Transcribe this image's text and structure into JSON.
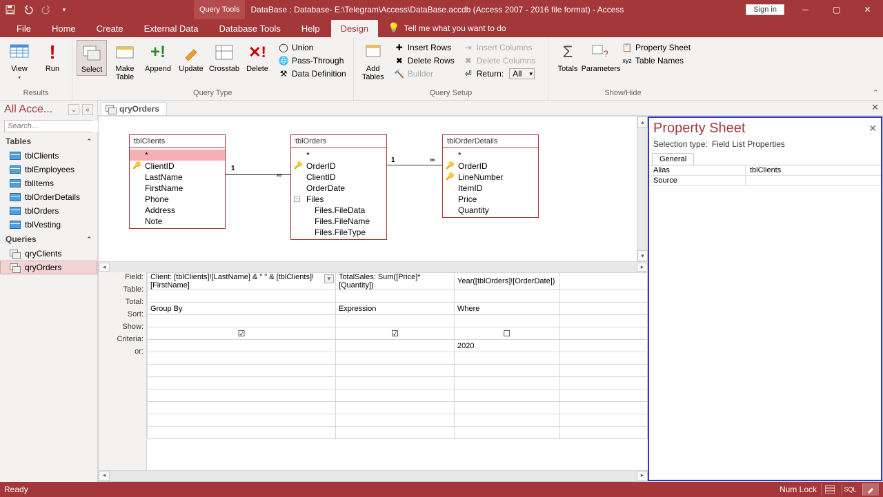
{
  "titlebar": {
    "tool_tab": "Query Tools",
    "title": "DataBase : Database- E:\\Telegram\\Access\\DataBase.accdb (Access 2007 - 2016 file format)  -  Access",
    "signin": "Sign in"
  },
  "tabs": {
    "file": "File",
    "home": "Home",
    "create": "Create",
    "external": "External Data",
    "dbtools": "Database Tools",
    "help": "Help",
    "design": "Design",
    "tellme": "Tell me what you want to do"
  },
  "ribbon": {
    "results": {
      "label": "Results",
      "view": "View",
      "run": "Run"
    },
    "querytype": {
      "label": "Query Type",
      "select": "Select",
      "make_table": "Make\nTable",
      "append": "Append",
      "update": "Update",
      "crosstab": "Crosstab",
      "delete": "Delete",
      "union": "Union",
      "passthrough": "Pass-Through",
      "datadef": "Data Definition"
    },
    "querysetup": {
      "label": "Query Setup",
      "add_tables": "Add\nTables",
      "insert_rows": "Insert Rows",
      "delete_rows": "Delete Rows",
      "builder": "Builder",
      "insert_cols": "Insert Columns",
      "delete_cols": "Delete Columns",
      "return": "Return:",
      "return_val": "All"
    },
    "showhide": {
      "label": "Show/Hide",
      "totals": "Totals",
      "parameters": "Parameters",
      "propsheet": "Property Sheet",
      "tablenames": "Table Names"
    }
  },
  "nav": {
    "title": "All Acce...",
    "search_placeholder": "Search...",
    "tables_hdr": "Tables",
    "tables": [
      "tblClients",
      "tblEmployees",
      "tblItems",
      "tblOrderDetails",
      "tblOrders",
      "tblVesting"
    ],
    "queries_hdr": "Queries",
    "queries": [
      "qryClients",
      "qryOrders"
    ]
  },
  "doctab": "qryOrders",
  "diagram": {
    "tblClients": {
      "title": "tblClients",
      "fields": [
        "*",
        "ClientID",
        "LastName",
        "FirstName",
        "Phone",
        "Address",
        "Note"
      ],
      "key_idx": 1,
      "sel_idx": 0
    },
    "tblOrders": {
      "title": "tblOrders",
      "fields": [
        "*",
        "OrderID",
        "ClientID",
        "OrderDate",
        "Files",
        "Files.FileData",
        "Files.FileName",
        "Files.FileType"
      ],
      "key_idx": 1
    },
    "tblOrderDetails": {
      "title": "tblOrderDetails",
      "fields": [
        "*",
        "OrderID",
        "LineNumber",
        "ItemID",
        "Price",
        "Quantity"
      ],
      "key_idx": [
        1,
        2
      ]
    },
    "rel1": {
      "l": "1",
      "r": "∞"
    },
    "rel2": {
      "l": "1",
      "r": "∞"
    }
  },
  "qbe": {
    "rows": [
      "Field:",
      "Table:",
      "Total:",
      "Sort:",
      "Show:",
      "Criteria:",
      "or:"
    ],
    "cols": [
      {
        "field": "Client: [tblClients]![LastName] & \" \" & [tblClients]![FirstName]",
        "total": "Group By",
        "show": true
      },
      {
        "field": "TotalSales: Sum([Price]*[Quantity])",
        "total": "Expression",
        "show": true
      },
      {
        "field": "Year([tblOrders]![OrderDate])",
        "total": "Where",
        "show": false,
        "criteria": "2020"
      }
    ]
  },
  "propsheet": {
    "title": "Property Sheet",
    "subtype_lbl": "Selection type:",
    "subtype_val": "Field List Properties",
    "tab": "General",
    "rows": [
      {
        "k": "Alias",
        "v": "tblClients"
      },
      {
        "k": "Source",
        "v": ""
      }
    ]
  },
  "status": {
    "left": "Ready",
    "numlock": "Num Lock",
    "sql": "SQL"
  }
}
